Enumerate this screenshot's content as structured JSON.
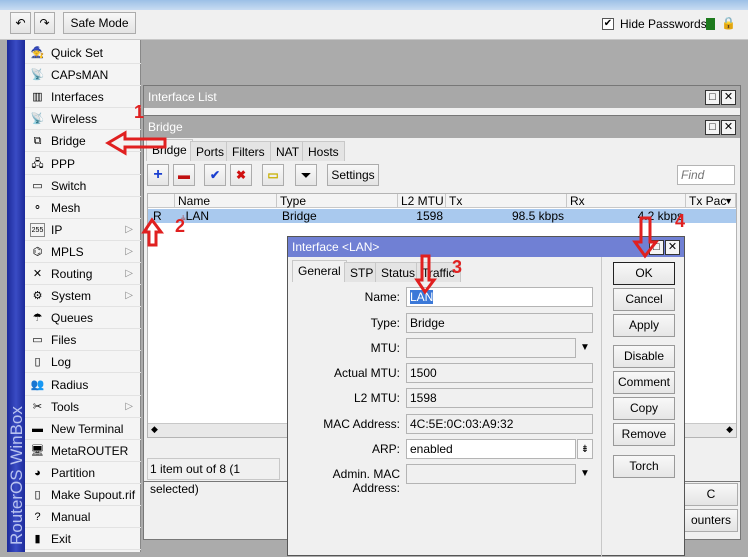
{
  "toolbar": {
    "undo_icon": "undo-icon",
    "redo_icon": "redo-icon",
    "safe_mode": "Safe Mode",
    "hide_passwords": "Hide Passwords",
    "hide_passwords_checked": true
  },
  "sidebar": {
    "brand": "RouterOS WinBox",
    "items": [
      {
        "label": "Quick Set",
        "icon": "🧙",
        "sub": false
      },
      {
        "label": "CAPsMAN",
        "icon": "📡",
        "sub": false
      },
      {
        "label": "Interfaces",
        "icon": "▥",
        "sub": false
      },
      {
        "label": "Wireless",
        "icon": "📡",
        "sub": false
      },
      {
        "label": "Bridge",
        "icon": "⧉",
        "sub": false
      },
      {
        "label": "PPP",
        "icon": "🖧",
        "sub": false
      },
      {
        "label": "Switch",
        "icon": "▭",
        "sub": false
      },
      {
        "label": "Mesh",
        "icon": "⚬",
        "sub": false
      },
      {
        "label": "IP",
        "icon": "255",
        "sub": true
      },
      {
        "label": "MPLS",
        "icon": "⌬",
        "sub": true
      },
      {
        "label": "Routing",
        "icon": "✕",
        "sub": true
      },
      {
        "label": "System",
        "icon": "⚙",
        "sub": true
      },
      {
        "label": "Queues",
        "icon": "☂",
        "sub": false
      },
      {
        "label": "Files",
        "icon": "▭",
        "sub": false
      },
      {
        "label": "Log",
        "icon": "▯",
        "sub": false
      },
      {
        "label": "Radius",
        "icon": "👥",
        "sub": false
      },
      {
        "label": "Tools",
        "icon": "✂",
        "sub": true
      },
      {
        "label": "New Terminal",
        "icon": "▬",
        "sub": false
      },
      {
        "label": "MetaROUTER",
        "icon": "🖥",
        "sub": false
      },
      {
        "label": "Partition",
        "icon": "◕",
        "sub": false
      },
      {
        "label": "Make Supout.rif",
        "icon": "▯",
        "sub": false
      },
      {
        "label": "Manual",
        "icon": "?",
        "sub": false
      },
      {
        "label": "Exit",
        "icon": "▮",
        "sub": false
      }
    ]
  },
  "interface_list": {
    "title": "Interface List",
    "btn_mac": "C Address",
    "btn_counters": "ounters"
  },
  "bridge": {
    "title": "Bridge",
    "tabs": [
      "Bridge",
      "Ports",
      "Filters",
      "NAT",
      "Hosts"
    ],
    "settings": "Settings",
    "find_placeholder": "Find",
    "columns": [
      "Name",
      "Type",
      "L2 MTU",
      "Tx",
      "Rx",
      "Tx Pac"
    ],
    "rows": [
      {
        "flag": "R",
        "name": "LAN",
        "type": "Bridge",
        "l2mtu": "1598",
        "tx": "98.5 kbps",
        "rx": "4.2 kbps",
        "txp": ""
      }
    ],
    "status": "1 item out of 8 (1 selected)"
  },
  "dialog": {
    "title": "Interface <LAN>",
    "tabs": [
      "General",
      "STP",
      "Status",
      "Traffic"
    ],
    "fields": [
      {
        "label": "Name:",
        "value": "LAN"
      },
      {
        "label": "Type:",
        "value": "Bridge"
      },
      {
        "label": "MTU:",
        "value": ""
      },
      {
        "label": "Actual MTU:",
        "value": "1500"
      },
      {
        "label": "L2 MTU:",
        "value": "1598"
      },
      {
        "label": "MAC Address:",
        "value": "4C:5E:0C:03:A9:32"
      },
      {
        "label": "ARP:",
        "value": "enabled"
      },
      {
        "label": "Admin. MAC Address:",
        "value": ""
      }
    ],
    "buttons": [
      "OK",
      "Cancel",
      "Apply",
      "Disable",
      "Comment",
      "Copy",
      "Remove",
      "Torch"
    ]
  },
  "annotations": [
    "1",
    "2",
    "3",
    "4"
  ],
  "colors": {
    "accent": "#e02020",
    "selected_row": "#a9c9ee",
    "dialog_title": "#7080d4"
  }
}
